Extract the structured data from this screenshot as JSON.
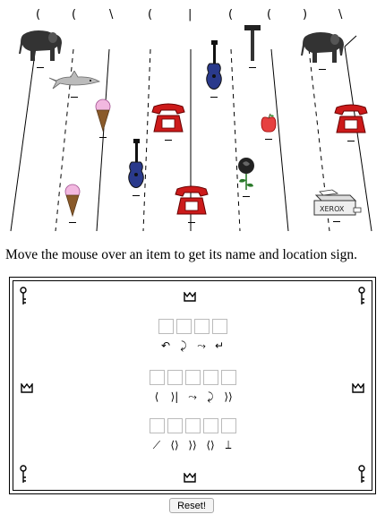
{
  "instruction": "Move the mouse over an item to get its name and location sign.",
  "reset_label": "Reset!",
  "ceiling_marks": [
    "(",
    "(",
    "\\",
    "(",
    "|",
    "(",
    "(",
    ")",
    "\\"
  ],
  "word_rows": [
    {
      "slots": 4,
      "signs": [
        "↶",
        "⤸",
        "⤳",
        "↵"
      ]
    },
    {
      "slots": 5,
      "signs": [
        "⟨",
        "⟩|",
        "⤳",
        "⤸",
        "⟩⟩"
      ]
    },
    {
      "slots": 5,
      "signs": [
        "⟋",
        "⟨⟩",
        "⟩⟩",
        "⟨⟩",
        "⟘"
      ]
    }
  ],
  "items": [
    {
      "name": "elephant",
      "icon": "elephant-icon"
    },
    {
      "name": "shark",
      "icon": "shark-icon"
    },
    {
      "name": "guitar",
      "icon": "guitar-icon"
    },
    {
      "name": "hammer",
      "icon": "hammer-icon"
    },
    {
      "name": "elephant",
      "icon": "elephant-icon"
    },
    {
      "name": "ice cream",
      "icon": "ice-cream-icon"
    },
    {
      "name": "telephone",
      "icon": "telephone-icon"
    },
    {
      "name": "apple",
      "icon": "apple-icon"
    },
    {
      "name": "telephone",
      "icon": "telephone-icon"
    },
    {
      "name": "guitar",
      "icon": "guitar-icon"
    },
    {
      "name": "rose",
      "icon": "rose-icon"
    },
    {
      "name": "ice cream",
      "icon": "ice-cream-icon"
    },
    {
      "name": "telephone",
      "icon": "telephone-icon"
    },
    {
      "name": "xerox machine",
      "icon": "xerox-machine-icon"
    }
  ],
  "xerox_label": "XEROX"
}
